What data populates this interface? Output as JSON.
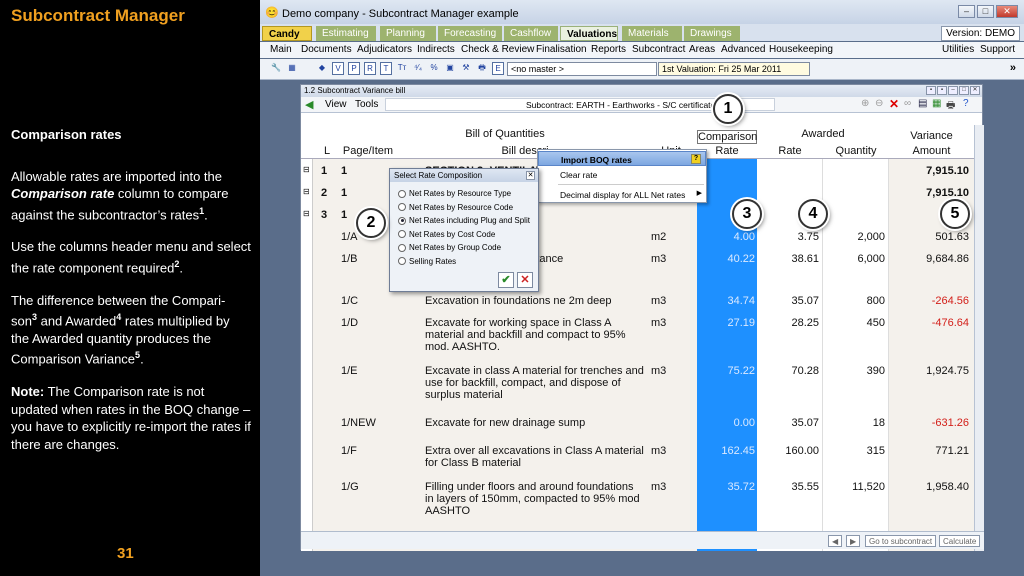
{
  "slide": {
    "title": "Subcontract Manager",
    "heading": "Comparison rates",
    "para1_a": "Allowable rates are imported into the ",
    "para1_em": "Comparison rate",
    "para1_b": " column to compare against the subcontractor’s rates",
    "para1_sup": "1",
    "para1_c": ".",
    "para2_a": "Use the columns header menu and select the rate component required",
    "para2_sup": "2",
    "para2_c": ".",
    "para3_a": "The difference between the Compari-son",
    "para3_sup1": "3",
    "para3_b": " and Awarded",
    "para3_sup2": "4",
    "para3_c": " rates multiplied by the Awarded quantity produces the Comparison Variance",
    "para3_sup3": "5",
    "para3_d": ".",
    "note_label": "Note:",
    "note_text": " The Comparison rate is not updated when rates in the BOQ change – you have to explicitly re-import the rates if there are changes.",
    "page_number": "31"
  },
  "window": {
    "title": "Demo company - Subcontract Manager example",
    "version": "Version: DEMO"
  },
  "tabs": [
    "Candy",
    "Estimating",
    "Planning",
    "Forecasting",
    "Cashflow",
    "Valuations",
    "Materials",
    "Drawings"
  ],
  "menu": [
    "Main",
    "Documents",
    "Adjudicators",
    "Indirects",
    "Check & Review",
    "Finalisation",
    "Reports",
    "Subcontract",
    "Areas",
    "Advanced",
    "Housekeeping"
  ],
  "menu_right": [
    "Utilities",
    "Support"
  ],
  "toolbar": {
    "master": "<no master >",
    "valuation": "1st Valuation: Fri 25 Mar 2011"
  },
  "inner": {
    "title": "1.2 Subcontract Variance bill",
    "menu_view": "View",
    "menu_tools": "Tools",
    "subcontract": "Subcontract: EARTH - Earthworks - S/C certificate #"
  },
  "headers": {
    "boq": "Bill of Quantities",
    "comparison": "Comparison",
    "awarded": "Awarded",
    "variance": "Variance",
    "l": "L",
    "page_item": "Page/Item",
    "bill_desc": "Bill descri",
    "unit": "Unit",
    "rate_c": "Rate",
    "rate_a": "Rate",
    "quantity": "Quantity",
    "amount": "Amount"
  },
  "rows": [
    {
      "lvl": "1",
      "item": "1",
      "desc": "SECTION 2: VENTILATION",
      "unit": "",
      "crate": "",
      "arate": "",
      "qty": "",
      "amt": "7,915.10",
      "neg": false,
      "bold": true
    },
    {
      "lvl": "2",
      "item": "1",
      "desc": "",
      "unit": "",
      "crate": "",
      "arate": "",
      "qty": "",
      "amt": "7,915.10",
      "neg": false,
      "bold": true
    },
    {
      "lvl": "3",
      "item": "1",
      "desc": "",
      "unit": "",
      "crate": "",
      "arate": "",
      "qty": "",
      "amt": "7,9",
      "neg": false,
      "bold": true
    },
    {
      "lvl": "",
      "item": "1/A",
      "desc": "",
      "unit": "m2",
      "crate": "4.00",
      "arate": "3.75",
      "qty": "2,000",
      "amt": "501.63",
      "neg": false,
      "bold": false
    },
    {
      "lvl": "",
      "item": "1/B",
      "desc": "A material and haul distance",
      "unit": "m3",
      "crate": "40.22",
      "arate": "38.61",
      "qty": "6,000",
      "amt": "9,684.86",
      "neg": false,
      "bold": false
    },
    {
      "lvl": "",
      "item": "1/C",
      "desc": "Excavation in foundations ne 2m deep",
      "unit": "m3",
      "crate": "34.74",
      "arate": "35.07",
      "qty": "800",
      "amt": "-264.56",
      "neg": true,
      "bold": false
    },
    {
      "lvl": "",
      "item": "1/D",
      "desc": "Excavate for working space in Class A material and backfill and compact to 95% mod. AASHTO.",
      "unit": "m3",
      "crate": "27.19",
      "arate": "28.25",
      "qty": "450",
      "amt": "-476.64",
      "neg": true,
      "bold": false
    },
    {
      "lvl": "",
      "item": "1/E",
      "desc": "Excavate in class A material for trenches and use for backfill, compact, and dispose of surplus material",
      "unit": "m3",
      "crate": "75.22",
      "arate": "70.28",
      "qty": "390",
      "amt": "1,924.75",
      "neg": false,
      "bold": false
    },
    {
      "lvl": "",
      "item": "1/NEW",
      "desc": "Excavate for new drainage sump",
      "unit": "",
      "crate": "0.00",
      "arate": "35.07",
      "qty": "18",
      "amt": "-631.26",
      "neg": true,
      "bold": false
    },
    {
      "lvl": "",
      "item": "1/F",
      "desc": "Extra over all excavations in Class A material for Class B material",
      "unit": "m3",
      "crate": "162.45",
      "arate": "160.00",
      "qty": "315",
      "amt": "771.21",
      "neg": false,
      "bold": false
    },
    {
      "lvl": "",
      "item": "1/G",
      "desc": "Filling under floors and around foundations in layers of 150mm, compacted to 95% mod AASHTO",
      "unit": "m3",
      "crate": "35.72",
      "arate": "35.55",
      "qty": "11,520",
      "amt": "1,958.40",
      "neg": false,
      "bold": false
    }
  ],
  "context_menu": [
    "Import BOQ rates",
    "Clear rate",
    "Decimal display for ALL Net rates"
  ],
  "dialog": {
    "title": "Select Rate Composition",
    "options": [
      "Net Rates by Resource Type",
      "Net Rates by Resource Code",
      "Net Rates including Plug and Split",
      "Net Rates by Cost Code",
      "Net Rates by Group Code",
      "Selling Rates"
    ],
    "selected": 2
  },
  "callouts": [
    "1",
    "2",
    "3",
    "4",
    "5"
  ],
  "bottom": {
    "goto": "Go to subcontract",
    "calculate": "Calculate"
  },
  "colors": {
    "accent_orange": "#f0a020",
    "comparison_blue": "#1e90ff",
    "negative_red": "#d3201a"
  }
}
